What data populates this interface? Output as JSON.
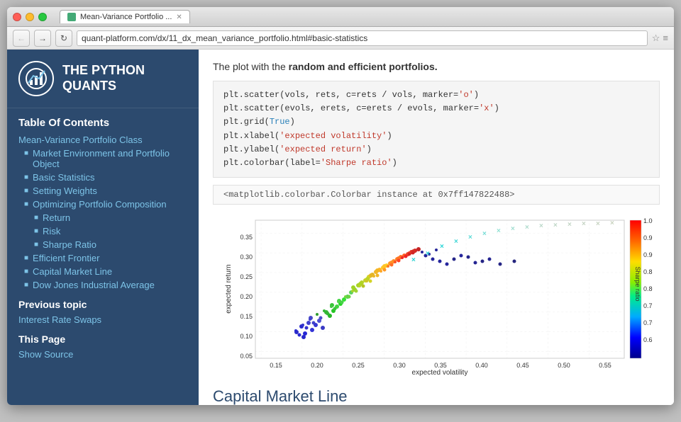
{
  "window": {
    "title": "Mean-Variance Portfolio...",
    "tab_label": "Mean-Variance Portfolio ...",
    "url": "quant-platform.com/dx/11_dx_mean_variance_portfolio.html#basic-statistics"
  },
  "nav": {
    "back_label": "←",
    "forward_label": "→",
    "refresh_label": "↻"
  },
  "sidebar": {
    "logo_line1": "THE PYTHON",
    "logo_line2": "QUANTS",
    "toc_title": "Table Of Contents",
    "toc_main_link": "Mean-Variance Portfolio Class",
    "items": [
      {
        "label": "Market Environment and Portfolio Object",
        "indent": 1
      },
      {
        "label": "Basic Statistics",
        "indent": 1
      },
      {
        "label": "Setting Weights",
        "indent": 1
      },
      {
        "label": "Optimizing Portfolio Composition",
        "indent": 1
      },
      {
        "label": "Return",
        "indent": 2
      },
      {
        "label": "Risk",
        "indent": 2
      },
      {
        "label": "Sharpe Ratio",
        "indent": 2
      },
      {
        "label": "Efficient Frontier",
        "indent": 1
      },
      {
        "label": "Capital Market Line",
        "indent": 1
      },
      {
        "label": "Dow Jones Industrial Average",
        "indent": 1
      }
    ],
    "prev_section_title": "Previous topic",
    "prev_topic": "Interest Rate Swaps",
    "this_page_title": "This Page",
    "show_source": "Show Source"
  },
  "content": {
    "intro": "The plot with the ",
    "intro_bold": "random and efficient portfolios.",
    "code_lines": [
      "plt.scatter(vols, rets, c=rets / vols, marker='o')",
      "plt.scatter(evols, erets, c=erets / evols, marker='x')",
      "plt.grid(True)",
      "plt.xlabel('expected volatility')",
      "plt.ylabel('expected return')",
      "plt.colorbar(label='Sharpe ratio')"
    ],
    "output_line": "<matplotlib.colorbar.Colorbar instance at 0x7ff147822488>",
    "section_heading": "Capital Market Line",
    "chart": {
      "x_label": "expected volatility",
      "y_label": "expected return",
      "colorbar_label": "Sharpe ratio",
      "x_ticks": [
        "0.15",
        "0.20",
        "0.25",
        "0.30",
        "0.35",
        "0.40",
        "0.45",
        "0.50",
        "0.55"
      ],
      "y_ticks": [
        "0.05",
        "0.10",
        "0.15",
        "0.20",
        "0.25",
        "0.30",
        "0.35"
      ],
      "colorbar_ticks": [
        "0.65",
        "0.70",
        "0.75",
        "0.80",
        "0.85",
        "0.90",
        "0.95",
        "1.00"
      ]
    }
  }
}
